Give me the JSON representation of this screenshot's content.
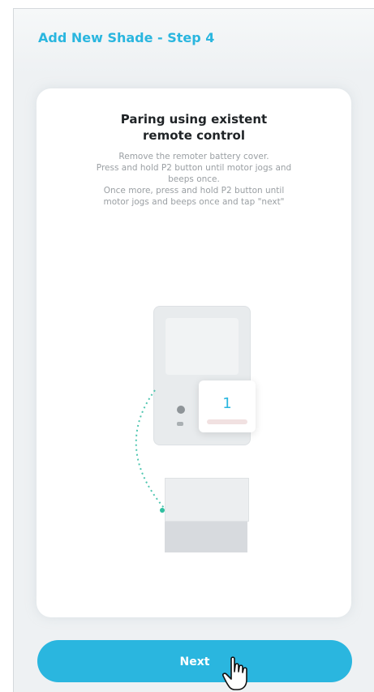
{
  "header": {
    "title": "Add New Shade - Step 4"
  },
  "card": {
    "title_lines": [
      "Paring using existent",
      "remote control"
    ],
    "description_lines": [
      "Remove the remoter battery cover.",
      "Press and hold P2 button until motor jogs and",
      "beeps once.",
      "Once more, press and hold P2 button until",
      "motor jogs and beeps once and tap \"next\""
    ]
  },
  "illustration": {
    "popup_number": "1"
  },
  "footer": {
    "next_label": "Next"
  },
  "colors": {
    "accent": "#2ab6df",
    "background": "#eef1f3",
    "card": "#ffffff"
  },
  "icons": {
    "cursor": "hand-pointer-icon"
  }
}
